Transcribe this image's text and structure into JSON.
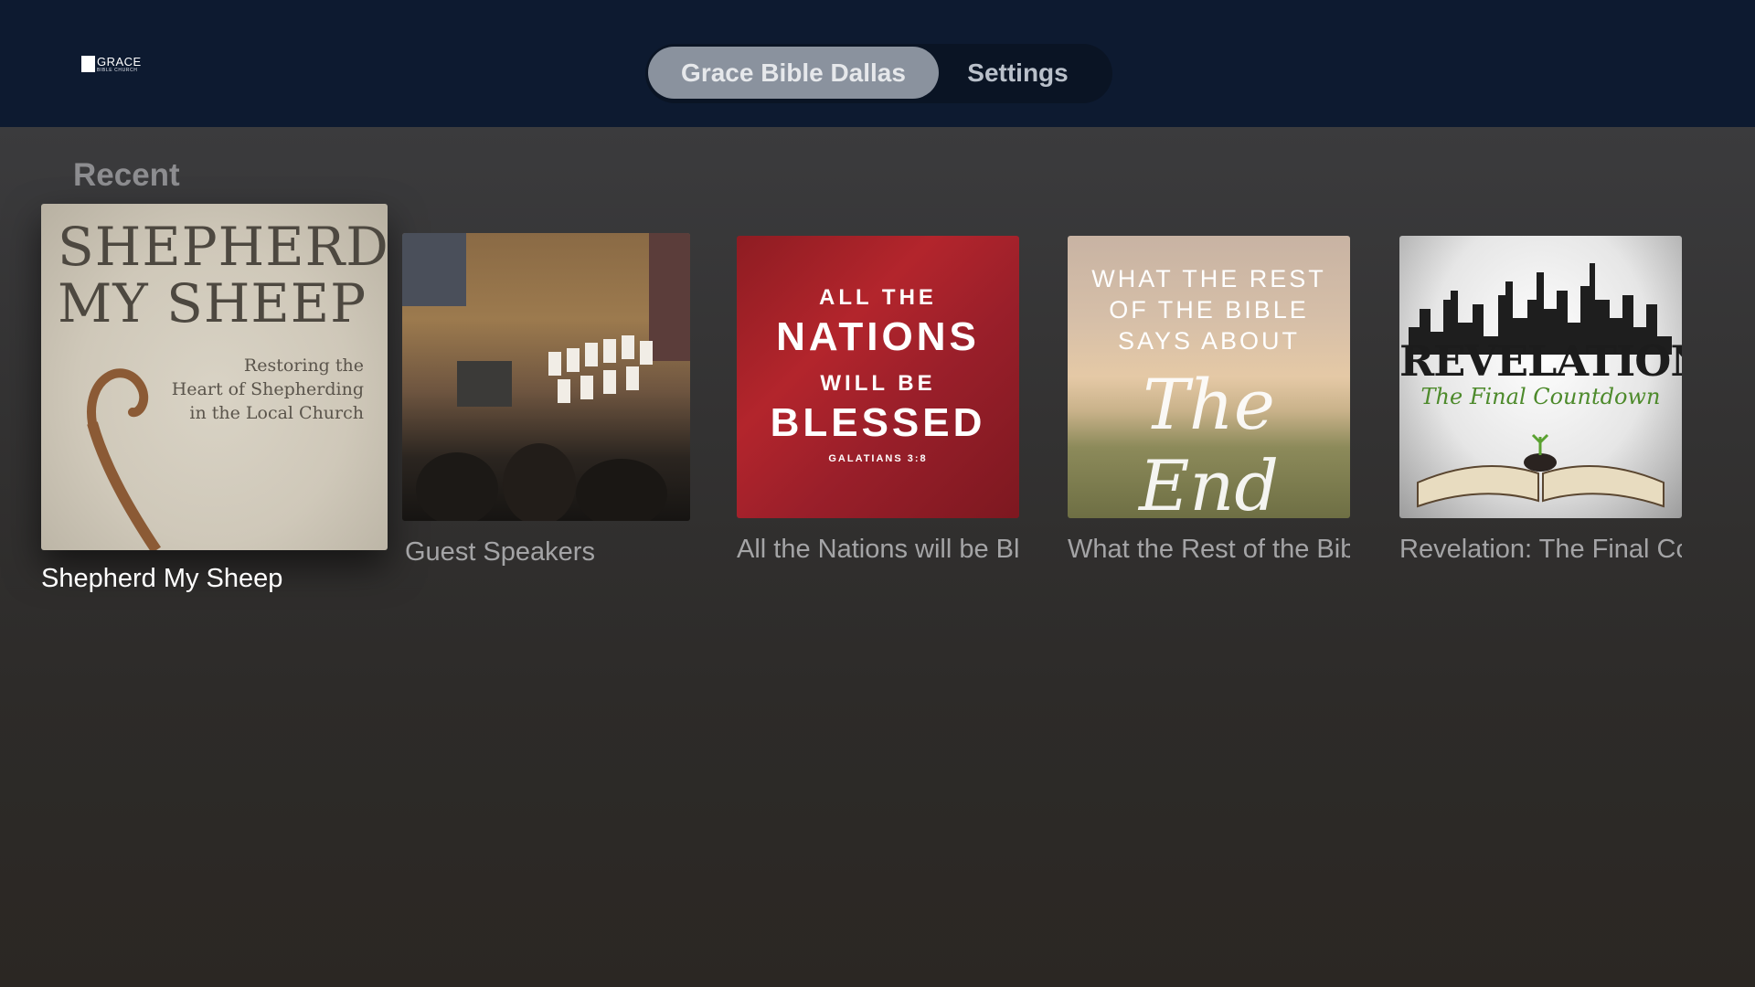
{
  "logo": {
    "main": "GRACE",
    "sub": "BIBLE CHURCH"
  },
  "tabs": [
    {
      "label": "Grace Bible Dallas",
      "selected": true
    },
    {
      "label": "Settings",
      "selected": false
    }
  ],
  "section": {
    "title": "Recent"
  },
  "items": [
    {
      "caption": "Shepherd My Sheep",
      "art": {
        "title_line1": "SHEPHERD",
        "title_line2": "MY SHEEP",
        "sub1": "Restoring the",
        "sub2": "Heart of Shepherding",
        "sub3": "in the Local Church"
      },
      "focused": true
    },
    {
      "caption": "Guest Speakers",
      "focused": false
    },
    {
      "caption": "All the Nations will be Blessed",
      "art": {
        "line1": "ALL THE",
        "line2": "NATIONS",
        "line3": "WILL BE",
        "line4": "BLESSED",
        "ref": "GALATIANS 3:8"
      },
      "focused": false
    },
    {
      "caption": "What the Rest of the Bible Says About The End",
      "art": {
        "line1": "WHAT THE REST",
        "line2": "OF THE BIBLE",
        "line3": "SAYS ABOUT",
        "script": "The End"
      },
      "focused": false
    },
    {
      "caption": "Revelation: The Final Countdown",
      "art": {
        "title": "REVELATION:",
        "sub": "The Final Countdown"
      },
      "focused": false
    }
  ],
  "colors": {
    "topbar": "#0d1a30",
    "tab_selected": "#8a929e",
    "background": "#333232"
  }
}
